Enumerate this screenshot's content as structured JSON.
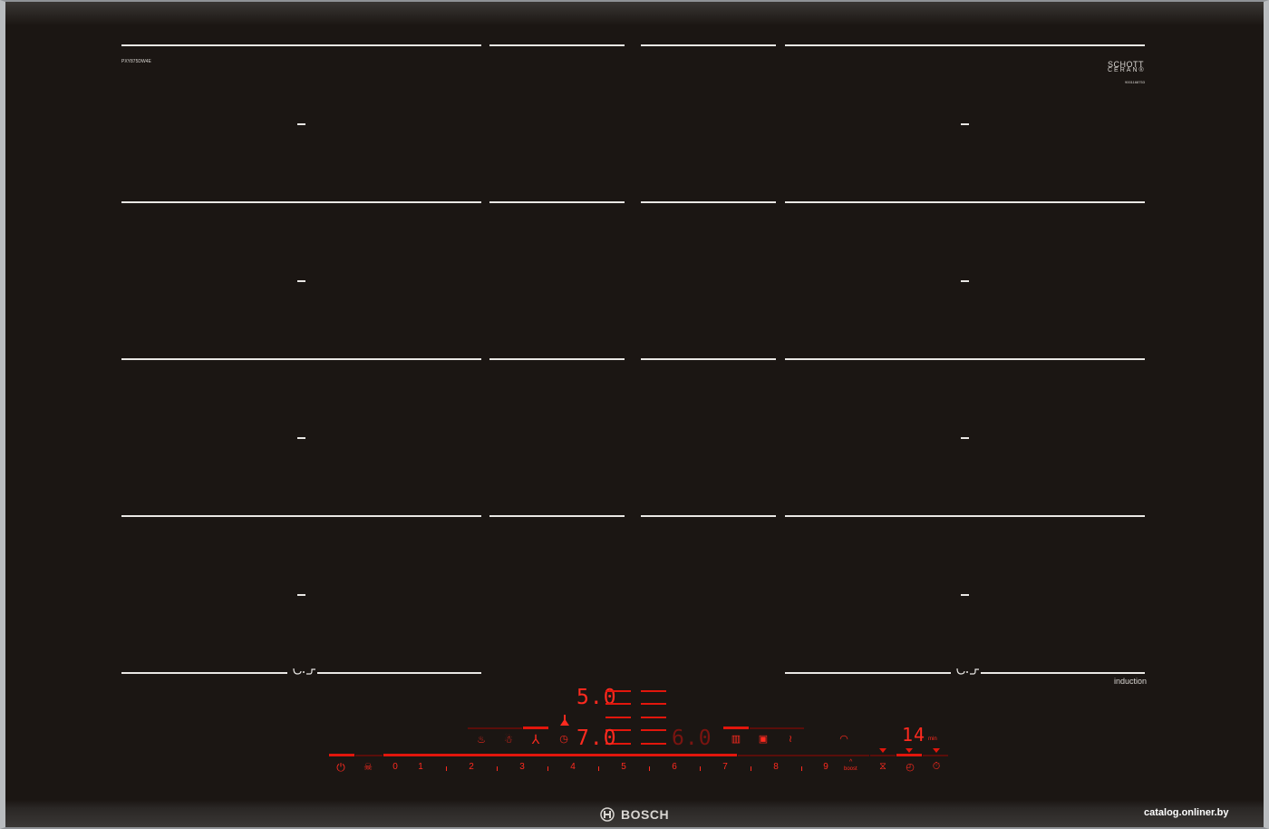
{
  "model_code": "PXY875DW4E",
  "schott_brand": "SCHOTT",
  "ceran_brand": "CERAN®",
  "serial_code": "9001168753",
  "induction_label": "induction",
  "brand_name": "BOSCH",
  "watermark": "catalog.onliner.by",
  "display": {
    "upper_value": "5.0",
    "left_value": "7.0",
    "right_value": "6.0",
    "timer_value": "14",
    "timer_unit": "min"
  },
  "scale": {
    "numbers": [
      "0",
      "1",
      "2",
      "3",
      "4",
      "5",
      "6",
      "7",
      "8",
      "9"
    ],
    "boost_label": "boost"
  },
  "icons": {
    "power": "power-icon",
    "child_lock": "child-lock-icon",
    "pot": "pot-icon",
    "bell_pepper": "frying-sensor-icon",
    "fan": "hood-fan-icon",
    "hood": "hood-icon",
    "clock": "clock-icon",
    "grid": "keep-warm-icon",
    "move": "move-function-icon",
    "wave": "flex-zone-icon",
    "wifi": "wifi-icon",
    "hourglass": "hourglass-icon",
    "timer": "timer-icon",
    "stopwatch": "stopwatch-icon"
  },
  "colors": {
    "glass": "#1b1613",
    "display_red": "#ff2a1f",
    "frame": "#b9bcbf"
  }
}
